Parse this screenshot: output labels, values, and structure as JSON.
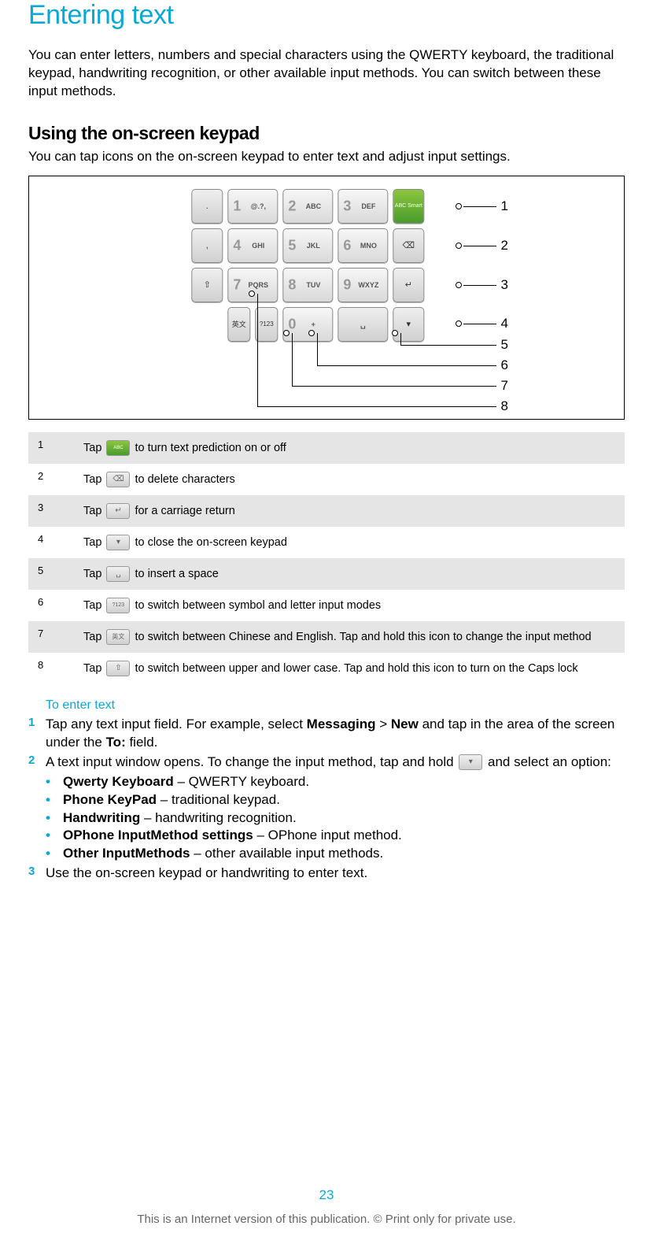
{
  "title": "Entering text",
  "intro": "You can enter letters, numbers and special characters using the QWERTY keyboard, the traditional keypad, handwriting recognition, or other available input methods. You can switch between these input methods.",
  "h2": "Using the on-screen keypad",
  "sub": "You can tap icons on the on-screen keypad to enter text and adjust input settings.",
  "keys": {
    "r1": [
      ".",
      "@.?,",
      "ABC",
      "DEF"
    ],
    "r2": [
      ",",
      "GHI",
      "JKL",
      "MNO"
    ],
    "r3": [
      "PQRS",
      "TUV",
      "WXYZ"
    ],
    "nums": {
      "r1": [
        "1",
        "2",
        "3"
      ],
      "r2": [
        "4",
        "5",
        "6"
      ],
      "r3": [
        "7",
        "8",
        "9"
      ],
      "r4": "0"
    },
    "abc_smart": "ABC\nSmart",
    "lang_key": "英文",
    "sym_key": "?123",
    "zero_plus": "+"
  },
  "callouts": [
    "1",
    "2",
    "3",
    "4",
    "5",
    "6",
    "7",
    "8"
  ],
  "legend": [
    {
      "n": "1",
      "pre": "Tap ",
      "icon": "abc-smart",
      "post": " to turn text prediction on or off"
    },
    {
      "n": "2",
      "pre": "Tap ",
      "icon": "backspace",
      "post": " to delete characters"
    },
    {
      "n": "3",
      "pre": "Tap ",
      "icon": "enter",
      "post": " for a carriage return"
    },
    {
      "n": "4",
      "pre": "Tap ",
      "icon": "close-kb",
      "post": " to close the on-screen keypad"
    },
    {
      "n": "5",
      "pre": "Tap ",
      "icon": "space",
      "post": " to insert a space"
    },
    {
      "n": "6",
      "pre": "Tap ",
      "icon": "sym",
      "post": " to switch between symbol and letter input modes"
    },
    {
      "n": "7",
      "pre": "Tap ",
      "icon": "lang",
      "post": " to switch between Chinese and English. Tap and hold this icon to change the input method"
    },
    {
      "n": "8",
      "pre": "Tap ",
      "icon": "shift",
      "post": " to switch between upper and lower case. Tap and hold this icon to turn on the Caps lock"
    }
  ],
  "h3": "To enter text",
  "steps": {
    "s1": {
      "num": "1",
      "pre": "Tap any text input field. For example, select ",
      "b1": "Messaging",
      "mid1": " > ",
      "b2": "New",
      "mid2": " and tap in the area of the screen under the ",
      "b3": "To:",
      "post": " field."
    },
    "s2": {
      "num": "2",
      "pre": "A text input window opens. To change the input method, tap and hold ",
      "post": " and select an option:"
    },
    "s2_options": [
      {
        "b": "Qwerty Keyboard",
        "t": " – QWERTY keyboard."
      },
      {
        "b": "Phone KeyPad",
        "t": " – traditional keypad."
      },
      {
        "b": "Handwriting",
        "t": " – handwriting recognition."
      },
      {
        "b": "OPhone InputMethod settings",
        "t": " – OPhone input method."
      },
      {
        "b": "Other InputMethods",
        "t": " – other available input methods."
      }
    ],
    "s3": {
      "num": "3",
      "text": "Use the on-screen keypad or handwriting to enter text."
    }
  },
  "page_number": "23",
  "copyright": "This is an Internet version of this publication. © Print only for private use."
}
